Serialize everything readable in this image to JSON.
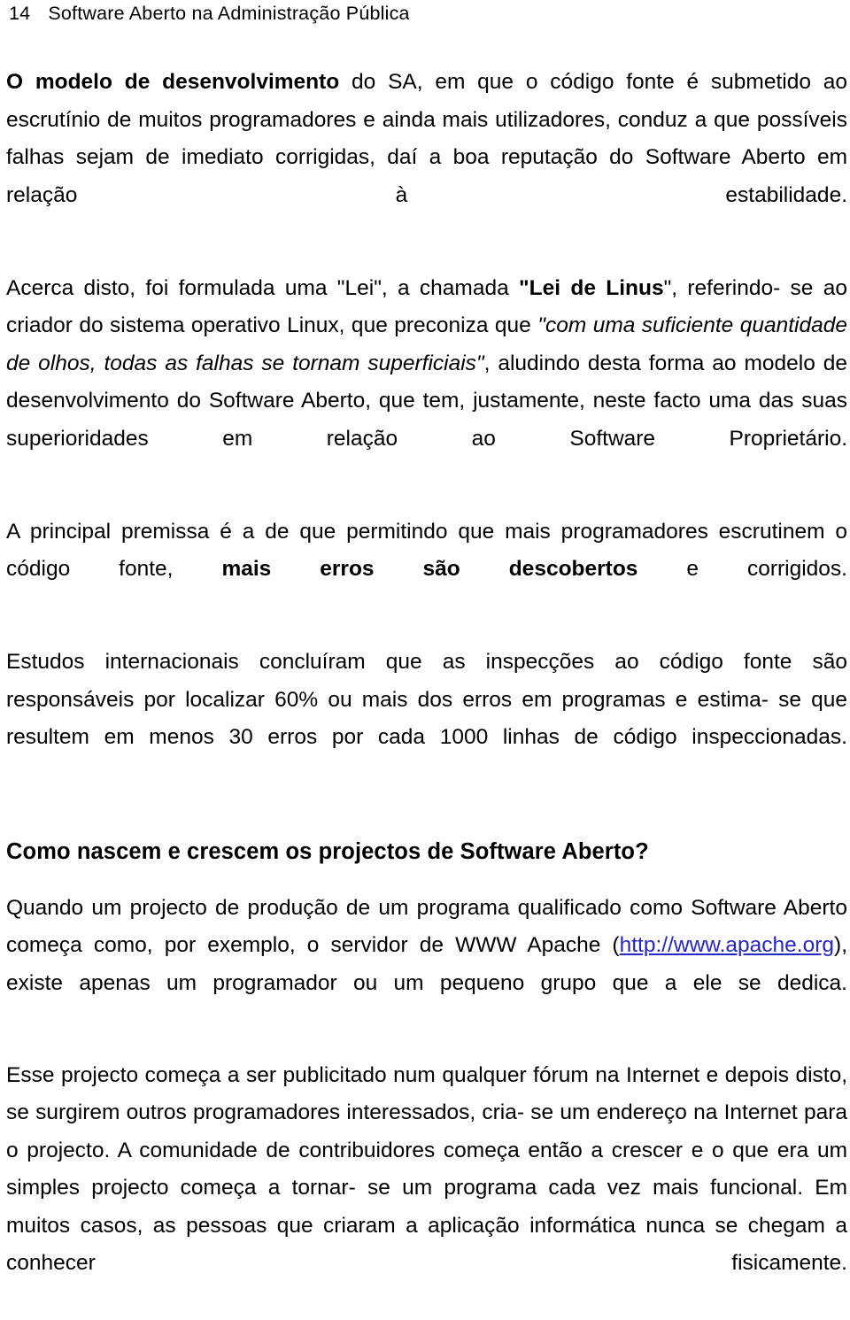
{
  "page": {
    "folio": "14",
    "running_head": "Software Aberto na Administração Pública"
  },
  "content": {
    "p1": {
      "lead_bold": "O modelo de desenvolvimento",
      "rest": " do SA, em que o código fonte é submetido ao escrutínio de muitos programadores e ainda mais utilizadores, conduz a que possíveis falhas sejam de imediato corrigidas, daí a boa reputação do Software Aberto em relação à estabilidade."
    },
    "p2": {
      "part1": "Acerca disto, foi formulada uma \"Lei\", a chamada ",
      "bold_term": "\"Lei de Linus",
      "part2": "\", referindo- se ao criador do sistema operativo Linux, que preconiza que ",
      "italic_quote": "\"com uma suficiente quantidade de olhos, todas as falhas se tornam superficiais\"",
      "part3": ", aludindo desta forma ao modelo de desenvolvimento do Software Aberto, que tem, justamente, neste facto uma das suas superioridades em relação ao Software Proprietário."
    },
    "p3": {
      "part1": "A principal premissa é a de que permitindo que mais programadores escrutinem o código fonte, ",
      "bold_term": "mais erros são descobertos",
      "part2": " e corrigidos."
    },
    "p4": {
      "text": "Estudos internacionais concluíram que as inspecções ao código fonte são responsáveis por localizar 60% ou mais dos erros em programas e estima- se que resultem em menos 30 erros por cada 1000 linhas de código inspeccionadas."
    },
    "heading": "Como nascem e crescem os projectos de Software Aberto?",
    "p5": {
      "part1": "Quando um projecto de produção de um programa qualificado como Software Aberto começa como, por exemplo, o servidor de WWW Apache (",
      "link": "http://www.apache.org",
      "part2": "), existe apenas um programador ou um pequeno grupo que a ele se dedica."
    },
    "p6": {
      "text": "Esse projecto começa a ser publicitado num qualquer fórum na Internet e depois disto, se surgirem outros programadores interessados, cria- se um endereço na Internet para o projecto. A comunidade de contribuidores começa então a crescer e o que era um simples projecto começa a tornar- se um programa cada vez mais funcional. Em muitos casos, as pessoas que criaram a aplicação informática nunca se chegam a conhecer fisicamente."
    }
  },
  "colors": {
    "text": "#000000",
    "link": "#2525c8",
    "background": "#ffffff"
  }
}
